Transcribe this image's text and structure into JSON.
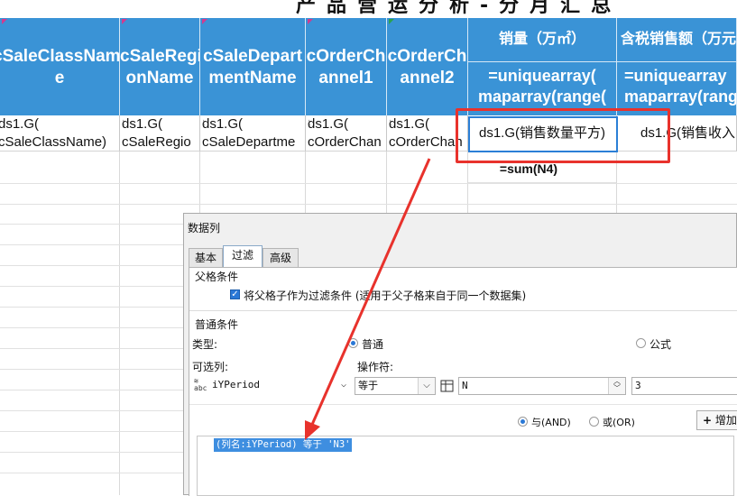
{
  "sheet": {
    "title": "产品营运分析-分月汇总",
    "headers": [
      {
        "label_line1": "cSaleClassNam",
        "label_line2": "e"
      },
      {
        "label_line1": "cSaleRegi",
        "label_line2": "onName"
      },
      {
        "label_line1": "cSaleDepart",
        "label_line2": "mentName"
      },
      {
        "label_line1": "cOrderCh",
        "label_line2": "annel1"
      },
      {
        "label_line1": "cOrderCh",
        "label_line2": "annel2"
      }
    ],
    "measure_headers": [
      {
        "label": "销量（万㎡）",
        "formula_line1": "=uniquearray(",
        "formula_line2": "maparray(range("
      },
      {
        "label": "含税销售额（万元",
        "formula_line1": "=uniquearray",
        "formula_line2": "maparray(range"
      }
    ],
    "data_row": [
      {
        "line1": "ds1.G(",
        "line2": "cSaleClassName)"
      },
      {
        "line1": "ds1.G(",
        "line2": "cSaleRegio"
      },
      {
        "line1": "ds1.G(",
        "line2": "cSaleDepartme"
      },
      {
        "line1": "ds1.G(",
        "line2": "cOrderChan"
      },
      {
        "line1": "ds1.G(",
        "line2": "cOrderChan"
      }
    ],
    "measure_cells": [
      "ds1.G(销售数量平方)",
      "ds1.G(销售收入"
    ],
    "sum_formula": "=sum(N4)",
    "colors": {
      "header_bg": "#3a93d6",
      "highlight_red": "#e8322c",
      "selection_blue": "#2b7fd6"
    }
  },
  "dialog": {
    "title": "数据列",
    "tabs": [
      "基本",
      "过滤",
      "高级"
    ],
    "active_tab": "过滤",
    "parent_section": "父格条件",
    "parent_checkbox_label": "将父格子作为过滤条件 (适用于父子格来自于同一个数据集)",
    "parent_checkbox_checked": true,
    "common_section": "普通条件",
    "type_label": "类型:",
    "type_option_normal": "普通",
    "type_option_formula": "公式",
    "selected_type": "普通",
    "column_label": "可选列:",
    "operator_label": "操作符:",
    "column_value": "iYPeriod",
    "operator_value": "等于",
    "param_value": "N",
    "value_field": "3",
    "and_label": "与(AND)",
    "or_label": "或(OR)",
    "logic_selected": "与(AND)",
    "add_button": "增加",
    "condition_item": "(列名:iYPeriod) 等于 'N3'",
    "icons": [
      "abc-column-icon",
      "cell-reference-icon",
      "plus-icon"
    ]
  }
}
